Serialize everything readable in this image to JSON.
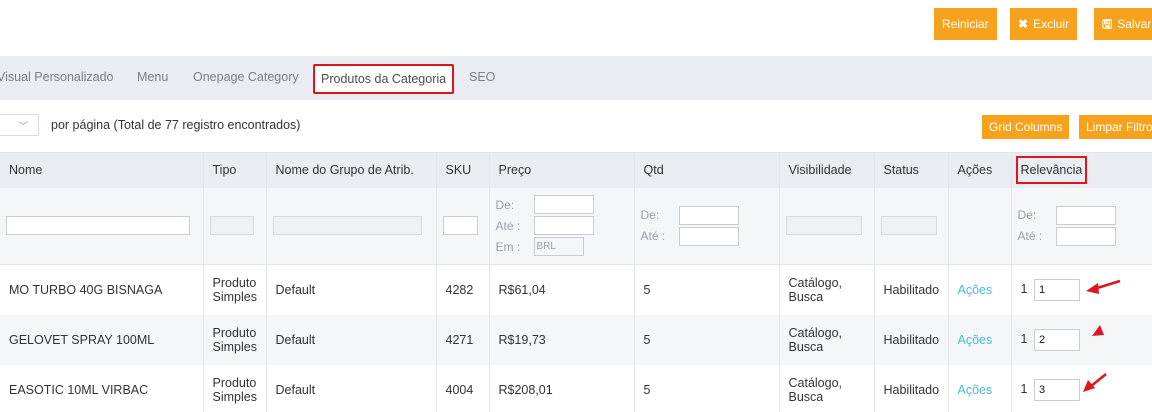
{
  "toolbar": {
    "reset_label": "Reiniciar",
    "delete_label": "Excluir",
    "save_label": "Salvar"
  },
  "tabs": [
    {
      "label": "Visual Personalizado"
    },
    {
      "label": "Menu"
    },
    {
      "label": "Onepage Category"
    },
    {
      "label": "Produtos da Categoria",
      "active": true
    },
    {
      "label": "SEO"
    }
  ],
  "pager": {
    "per_page_text": "por página (Total de ",
    "total": "77",
    "suffix": " registro encontrados)",
    "grid_columns_label": "Grid Columns",
    "clear_filters_label": "Limpar Filtros"
  },
  "columns": [
    "Nome",
    "Tipo",
    "Nome do Grupo de Atrib.",
    "SKU",
    "Preço",
    "Qtd",
    "Visibilidade",
    "Status",
    "Ações",
    "Relevância"
  ],
  "filters": {
    "from_label": "De:",
    "to_label": "Até :",
    "in_label": "Em :",
    "currency": "BRL"
  },
  "rows": [
    {
      "name": "MO TURBO 40G BISNAGA",
      "type_line1": "Produto",
      "type_line2": "Simples",
      "attr_group": "Default",
      "sku": "4282",
      "price": "R$61,04",
      "qty": "5",
      "vis_line1": "Catálogo,",
      "vis_line2": "Busca",
      "status": "Habilitado",
      "actions": "Ações",
      "relevance": "1",
      "position": "1"
    },
    {
      "name": "GELOVET SPRAY 100ML",
      "type_line1": "Produto",
      "type_line2": "Simples",
      "attr_group": "Default",
      "sku": "4271",
      "price": "R$19,73",
      "qty": "5",
      "vis_line1": "Catálogo,",
      "vis_line2": "Busca",
      "status": "Habilitado",
      "actions": "Ações",
      "relevance": "1",
      "position": "2"
    },
    {
      "name": "EASOTIC 10ML VIRBAC",
      "type_line1": "Produto",
      "type_line2": "Simples",
      "attr_group": "Default",
      "sku": "4004",
      "price": "R$208,01",
      "qty": "5",
      "vis_line1": "Catálogo,",
      "vis_line2": "Busca",
      "status": "Habilitado",
      "actions": "Ações",
      "relevance": "1",
      "position": "3"
    }
  ],
  "colors": {
    "accent": "#f7a21c",
    "highlight": "#e0141c",
    "link": "#4fb8e0"
  }
}
